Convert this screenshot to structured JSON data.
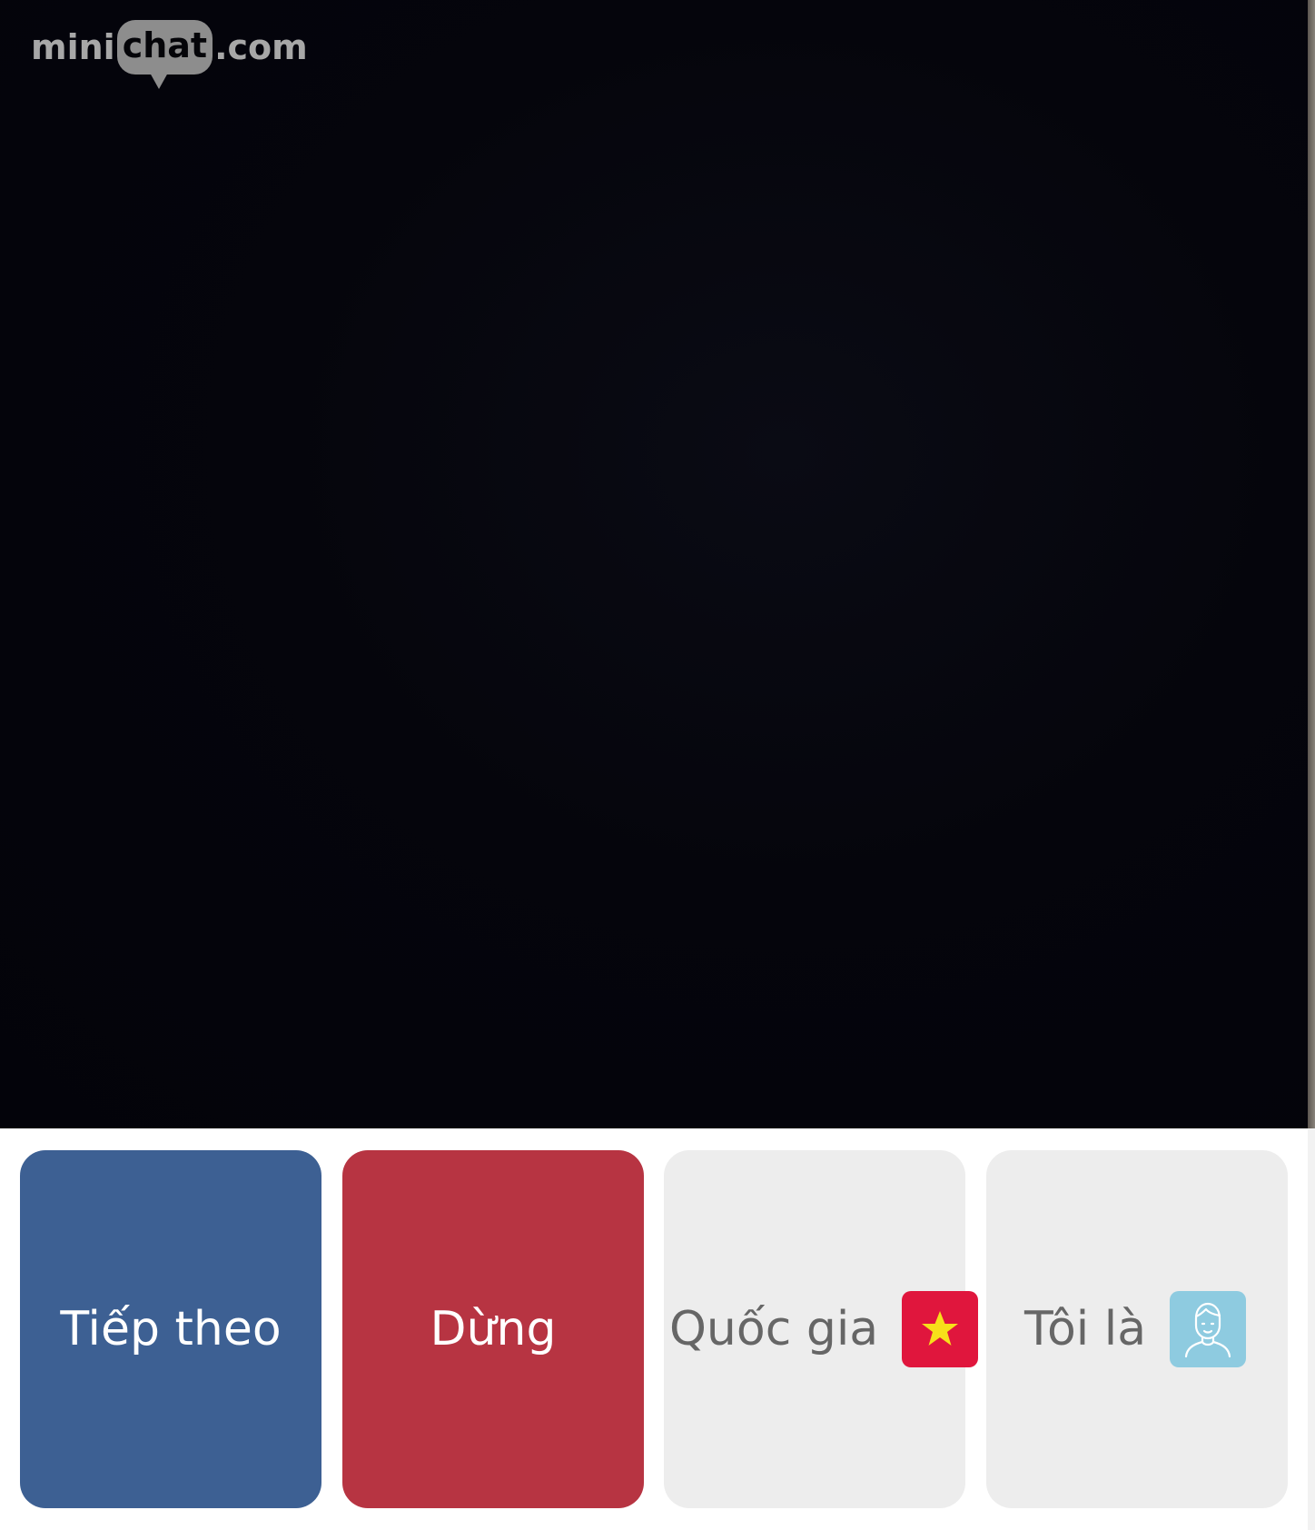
{
  "logo": {
    "prefix": "mini",
    "bubble_word": "chat",
    "suffix": ".com"
  },
  "controls": {
    "next_label": "Tiếp theo",
    "stop_label": "Dừng",
    "country_label": "Quốc gia",
    "country_flag_icon": "vietnam-flag-icon",
    "iam_label": "Tôi là",
    "iam_icon": "male-avatar-icon"
  },
  "colors": {
    "next_button": "#3d6093",
    "stop_button": "#b73442",
    "neutral_button": "#ededed",
    "flag_red": "#e0163d",
    "flag_star": "#f7e01a",
    "avatar_bg": "#8ecbe0",
    "video_bg": "#03030a"
  }
}
